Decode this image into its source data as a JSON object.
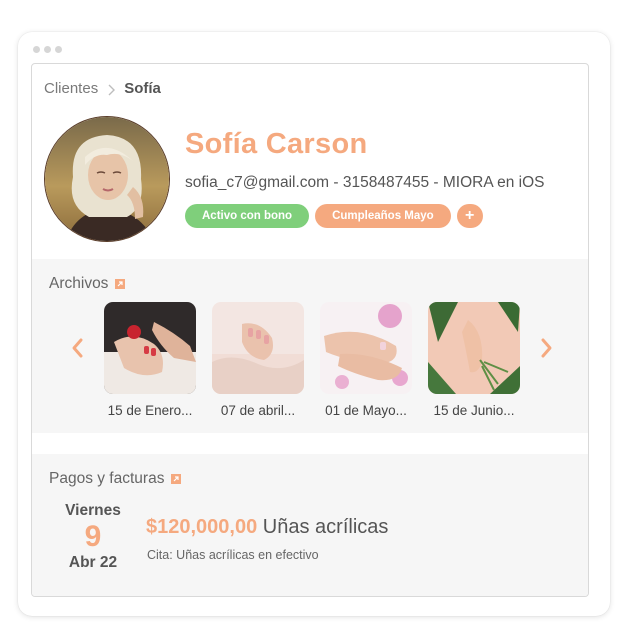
{
  "breadcrumb": {
    "parent": "Clientes",
    "current": "Sofía"
  },
  "profile": {
    "name": "Sofía Carson",
    "info": "sofia_c7@gmail.com - 3158487455 - MIORA en iOS",
    "tags": [
      {
        "label": "Activo con bono",
        "color": "#7fcf7b"
      },
      {
        "label": "Cumpleaños Mayo",
        "color": "#f5a97f"
      }
    ],
    "add_tag_label": "+"
  },
  "files": {
    "title": "Archivos",
    "items": [
      {
        "label": "15 de Enero..."
      },
      {
        "label": "07 de abril..."
      },
      {
        "label": "01 de Mayo..."
      },
      {
        "label": "15 de Junio..."
      }
    ]
  },
  "payments": {
    "title": "Pagos y facturas",
    "day_name": "Viernes",
    "day_number": "9",
    "month_year": "Abr 22",
    "amount": "$120,000,00",
    "service": "Uñas acrílicas",
    "note": "Cita: Uñas acrílicas en efectivo"
  },
  "colors": {
    "accent": "#f5a97f",
    "green": "#7fcf7b"
  },
  "icons": [
    "chevron-right-icon",
    "external-link-icon",
    "arrow-left-icon",
    "arrow-right-icon"
  ]
}
